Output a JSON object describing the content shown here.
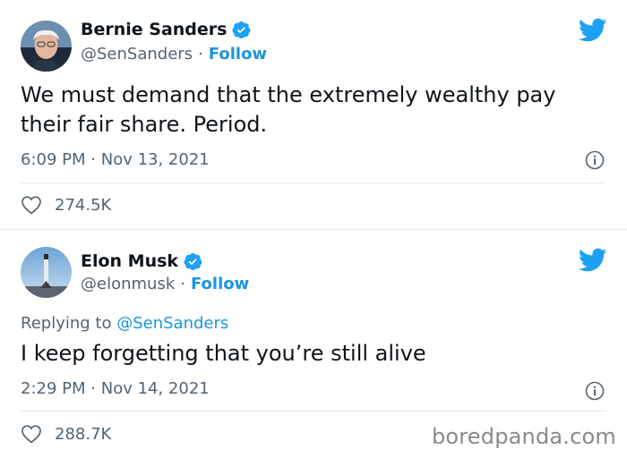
{
  "tweets": [
    {
      "display_name": "Bernie Sanders",
      "handle": "@SenSanders",
      "separator": "·",
      "follow_label": "Follow",
      "text": "We must demand that the extremely wealthy pay their fair share. Period.",
      "time": "6:09 PM",
      "date": "Nov 13, 2021",
      "likes": "274.5K",
      "avatar_icon": "person-avatar",
      "verified_icon": "verified-badge-icon"
    },
    {
      "display_name": "Elon Musk",
      "handle": "@elonmusk",
      "separator": "·",
      "follow_label": "Follow",
      "replying_prefix": "Replying to",
      "replying_to": "@SenSanders",
      "text": "I keep forgetting that you’re still alive",
      "time": "2:29 PM",
      "date": "Nov 14, 2021",
      "likes": "288.7K",
      "avatar_icon": "rocket-avatar",
      "verified_icon": "verified-badge-icon"
    }
  ],
  "watermark": "boredpanda.com",
  "colors": {
    "accent": "#1b95e0",
    "twitter_blue": "#1da1f2",
    "muted_text": "#536471",
    "divider": "#e1e8ed"
  }
}
